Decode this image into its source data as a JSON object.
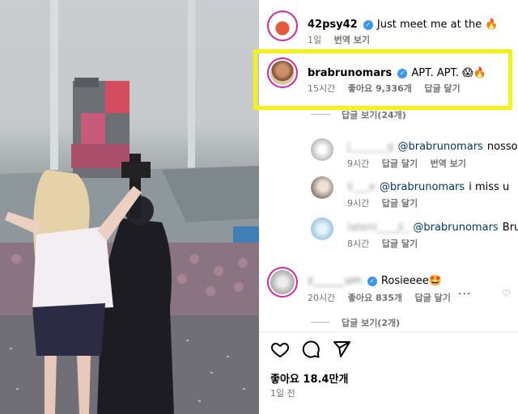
{
  "post_caption": {
    "username": "42psy42",
    "text": "Just meet me at the 🔥",
    "time": "1일",
    "translate": "번역 보기"
  },
  "comments": [
    {
      "username": "brabrunomars",
      "text": "APT. APT. 😱🔥",
      "time": "15시간",
      "likes": "좋아요 9,336개",
      "reply": "답글 달기",
      "highlighted": true
    }
  ],
  "replies_group_1": {
    "view_replies": "답글 보기(24개)",
    "items": [
      {
        "username": "j_______g",
        "mention": "@brabrunomars",
        "text": "nosso B",
        "time": "9시간",
        "reply": "답글 달기",
        "translate": "번역 보기"
      },
      {
        "username": "li___e",
        "mention": "@brabrunomars",
        "text": "i miss u",
        "time": "9시간",
        "reply": "답글 달기"
      },
      {
        "username": "lateni____ji_",
        "mention": "@brabrunomars",
        "text": "Brune",
        "time": "8시간",
        "reply": "답글 달기"
      }
    ]
  },
  "comment_2": {
    "username": "z______um",
    "text": "Rosieeee🤩",
    "time": "20시간",
    "likes": "좋아요 835개",
    "reply": "답글 달기",
    "more": "···",
    "view_replies": "답글 보기(2개)"
  },
  "footer": {
    "likes": "좋아요 18.4만개",
    "posted": "1일 전"
  },
  "icons": [
    "heart-icon",
    "comment-icon",
    "share-icon",
    "verified-icon"
  ],
  "colors": {
    "highlight": "#f4f414",
    "verified": "#3897f0",
    "mention": "#00376b",
    "meta": "#737373"
  }
}
